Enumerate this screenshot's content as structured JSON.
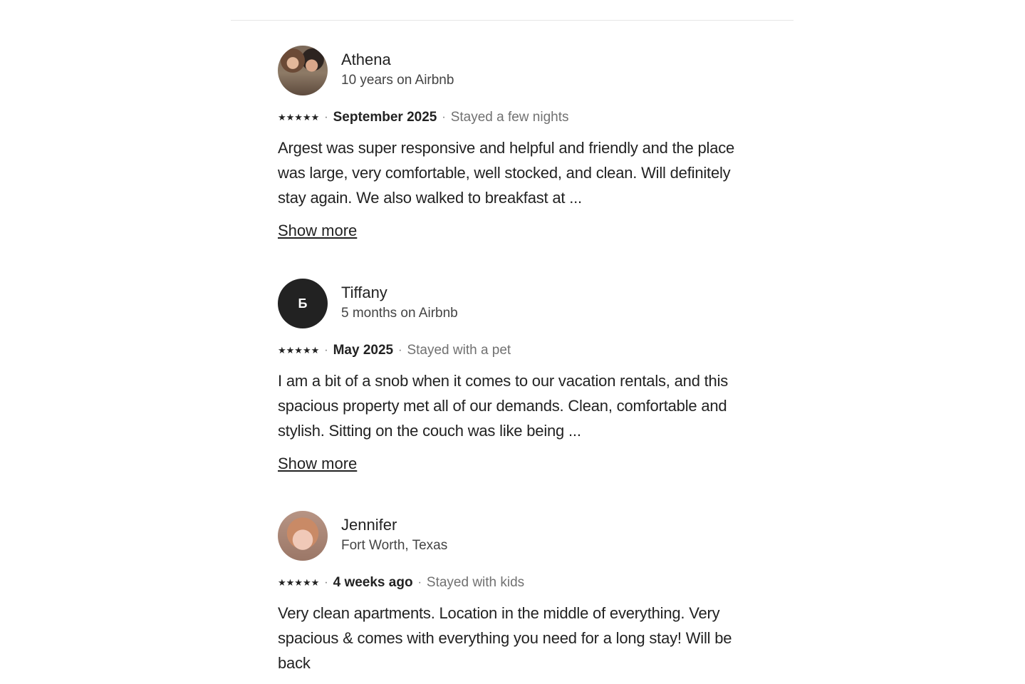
{
  "reviews": [
    {
      "name": "Athena",
      "subtitle": "10 years on Airbnb",
      "avatar": "photo",
      "stars": "★★★★★",
      "dot": "·",
      "date": "September 2025",
      "stay": "Stayed a few nights",
      "text": "Argest was super responsive and helpful and friendly and the place was large, very comfortable, well stocked, and clean. Will definitely stay again. We also walked to breakfast at ...",
      "show_more": "Show more"
    },
    {
      "name": "Tiffany",
      "subtitle": "5 months on Airbnb",
      "avatar_initial": "Б",
      "stars": "★★★★★",
      "dot": "·",
      "date": "May 2025",
      "stay": "Stayed with a pet",
      "text": "I am a bit of a snob when it comes to our vacation rentals, and this spacious property met all of our demands. Clean, comfortable and stylish. Sitting on the couch was like being ...",
      "show_more": "Show more"
    },
    {
      "name": "Jennifer",
      "subtitle": "Fort Worth, Texas",
      "avatar": "photo",
      "stars": "★★★★★",
      "dot": "·",
      "date": "4 weeks ago",
      "stay": "Stayed with kids",
      "text": "Very clean apartments. Location in the middle of everything. Very spacious & comes with everything you need for a long stay! Will be back"
    }
  ],
  "rating": {
    "stars": 5,
    "max": 5
  }
}
